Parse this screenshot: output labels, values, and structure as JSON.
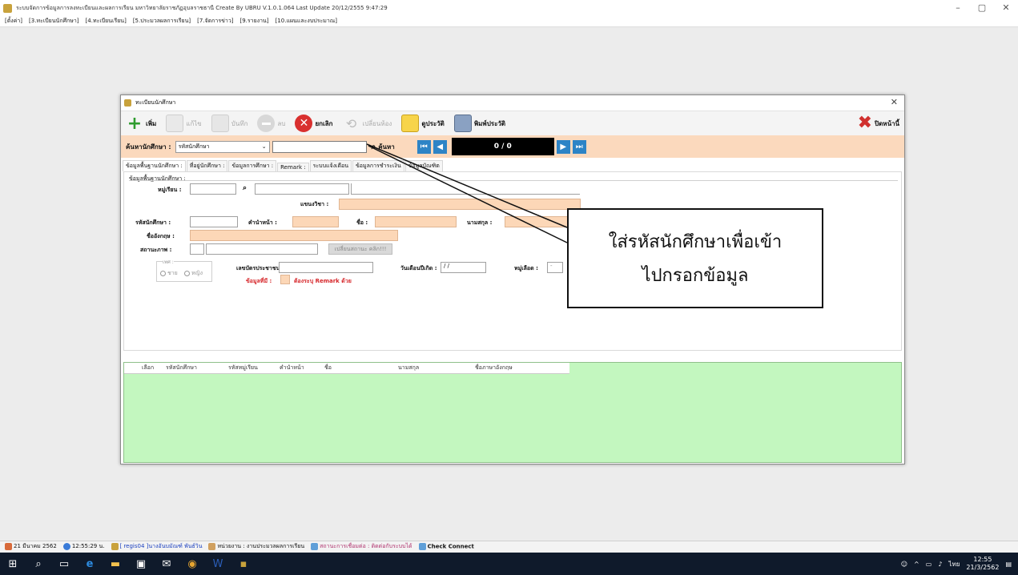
{
  "window": {
    "title": "ระบบจัดการข้อมูลการลงทะเบียนและผลการเรียน มหาวิทยาลัยราชภัฏอุบลราชธานี Create By UBRU   V.1.0.1.064 Last Update 20/12/2555 9:47:29",
    "min": "–",
    "max": "▢",
    "close": "✕"
  },
  "menu": [
    "[ตั้งค่า]",
    "[3.ทะเบียนนักศึกษา]",
    "[4.ทะเบียนเรียน]",
    "[5.ประมวลผลการเรียน]",
    "[7.จัดการข่าว]",
    "[9.รายงาน]",
    "[10.แผนและงบประมาณ]"
  ],
  "dialog": {
    "title": "ทะเบียนนักศึกษา",
    "close": "✕",
    "toolbar": {
      "add": "เพิ่ม",
      "edit": "แก้ไข",
      "save": "บันทึก",
      "delete": "ลบ",
      "cancel": "ยกเลิก",
      "move_class": "เปลี่ยนห้อง",
      "view_history": "ดูประวัติ",
      "print_history": "พิมพ์ประวัติ",
      "close_page": "ปิดหน้านี้"
    },
    "search": {
      "label": "ค้นหานักศึกษา :",
      "field_select": "รหัสนักศึกษา",
      "button": "ค้นหา",
      "pager": "0 / 0"
    },
    "tabs": [
      "ข้อมูลพื้นฐานนักศึกษา :",
      "ที่อยู่นักศึกษา :",
      "ข้อมูลการศึกษา :",
      "Remark :",
      "ระบบแจ้งเตือน",
      "ข้อมูลการชำระเงิน",
      "ข้อมูลบัณฑิต"
    ],
    "form": {
      "group_title": "ข้อมูลพื้นฐานนักศึกษา :",
      "class_group": "หมู่เรียน :",
      "major": "แขนงวิชา :",
      "student_id": "รหัสนักศึกษา :",
      "prefix": "คำนำหน้า :",
      "first_name": "ชื่อ :",
      "last_name": "นามสกุล :",
      "english_name": "ชื่ออังกฤษ :",
      "status": "สถานะภาพ :",
      "change_status": "เปลี่ยนสถานะ คลิก!!!",
      "gender_group": "เพศ :",
      "male": "ชาย",
      "female": "หญิง",
      "citizen_id": "เลขบัตรประชาชน :",
      "birthdate": "วันเดือนปีเกิด :",
      "birthdate_value": "/ /",
      "blood_group": "หมู่เลือด :",
      "blood_value": "-",
      "defect": "ข้อมูลที่มี :",
      "defect_note": "ต้องระบุ Remark ด้วย"
    },
    "grid_columns": [
      "เลือก",
      "รหัสนักศึกษา",
      "รหัสหมู่เรียน",
      "คำนำหน้า",
      "ชื่อ",
      "นามสกุล",
      "ชื่อภาษาอังกฤษ"
    ]
  },
  "callout": {
    "line1": "ใส่รหัสนักศึกษาเพื่อเข้า",
    "line2": "ไปกรอกข้อมูล"
  },
  "status": {
    "date": "21 มีนาคม 2562",
    "time": "12:55:29 น.",
    "user": "[ regis04 ]นางอันบมัณฑ์ พันธ์วิน",
    "unit": "หน่วยงาน : งานประมวลผลการเรียน",
    "conn": "สถานะการเชื่อมต่อ : ติดต่อกับระบบได้",
    "check": "Check Connect"
  },
  "tray": {
    "lang": "ไทย",
    "time": "12:55",
    "date": "21/3/2562"
  }
}
